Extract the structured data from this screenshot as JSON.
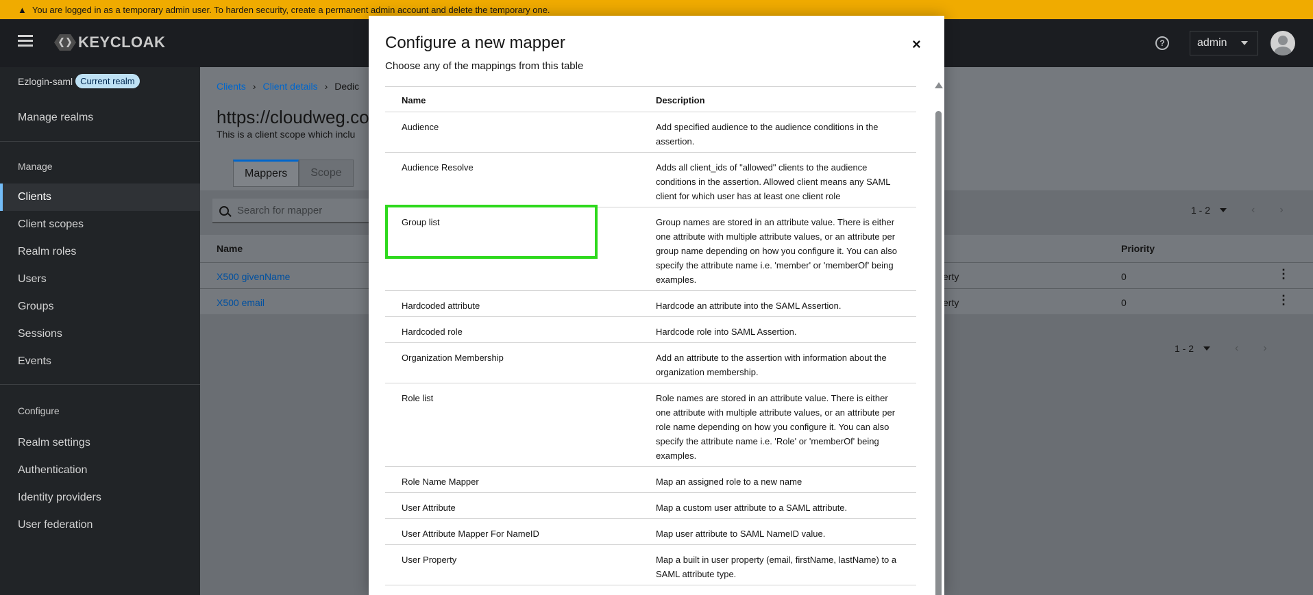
{
  "banner": {
    "text": "You are logged in as a temporary admin user. To harden security, create a permanent admin account and delete the temporary one."
  },
  "header": {
    "brand": "KEYCLOAK",
    "user": "admin"
  },
  "sidebar": {
    "realm": "Ezlogin-saml",
    "realm_badge": "Current realm",
    "manage_realms": "Manage realms",
    "manage_section": "Manage",
    "manage_items": [
      "Clients",
      "Client scopes",
      "Realm roles",
      "Users",
      "Groups",
      "Sessions",
      "Events"
    ],
    "configure_section": "Configure",
    "configure_items": [
      "Realm settings",
      "Authentication",
      "Identity providers",
      "User federation"
    ]
  },
  "page": {
    "breadcrumbs": [
      "Clients",
      "Client details",
      "Dedic"
    ],
    "title": "https://cloudweg.co",
    "description": "This is a client scope which inclu",
    "tabs": [
      "Mappers",
      "Scope"
    ],
    "search_placeholder": "Search for mapper",
    "pagination": "1 - 2",
    "table": {
      "columns": [
        "Name",
        "Priority"
      ],
      "rows": [
        {
          "name": "X500 givenName",
          "type_fragment": "erty",
          "priority": "0"
        },
        {
          "name": "X500 email",
          "type_fragment": "erty",
          "priority": "0"
        }
      ]
    }
  },
  "modal": {
    "title": "Configure a new mapper",
    "subtitle": "Choose any of the mappings from this table",
    "close": "×",
    "columns": [
      "Name",
      "Description"
    ],
    "rows": [
      {
        "name": "Audience",
        "description": "Add specified audience to the audience conditions in the assertion."
      },
      {
        "name": "Audience Resolve",
        "description": "Adds all client_ids of \"allowed\" clients to the audience conditions in the assertion. Allowed client means any SAML client for which user has at least one client role"
      },
      {
        "name": "Group list",
        "description": "Group names are stored in an attribute value. There is either one attribute with multiple attribute values, or an attribute per group name depending on how you configure it. You can also specify the attribute name i.e. 'member' or 'memberOf' being examples."
      },
      {
        "name": "Hardcoded attribute",
        "description": "Hardcode an attribute into the SAML Assertion."
      },
      {
        "name": "Hardcoded role",
        "description": "Hardcode role into SAML Assertion."
      },
      {
        "name": "Organization Membership",
        "description": "Add an attribute to the assertion with information about the organization membership."
      },
      {
        "name": "Role list",
        "description": "Role names are stored in an attribute value. There is either one attribute with multiple attribute values, or an attribute per role name depending on how you configure it. You can also specify the attribute name i.e. 'Role' or 'memberOf' being examples."
      },
      {
        "name": "Role Name Mapper",
        "description": "Map an assigned role to a new name"
      },
      {
        "name": "User Attribute",
        "description": "Map a custom user attribute to a SAML attribute."
      },
      {
        "name": "User Attribute Mapper For NameID",
        "description": "Map user attribute to SAML NameID value."
      },
      {
        "name": "User Property",
        "description": "Map a built in user property (email, firstName, lastName) to a SAML attribute type."
      }
    ]
  },
  "colors": {
    "banner": "#f0ab00",
    "masthead": "#1b1d21",
    "sidebar": "#212427",
    "link": "#0066cc",
    "highlight": "#2ed91d"
  }
}
